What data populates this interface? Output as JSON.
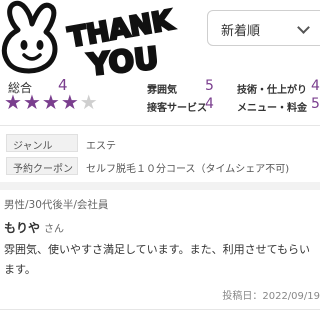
{
  "sort": {
    "selected": "新着順"
  },
  "ratings": {
    "overall_label": "総合",
    "overall_value": "4",
    "stars_filled": 4,
    "stars_total": 5,
    "categories": [
      {
        "label": "雰囲気",
        "value": "5"
      },
      {
        "label": "技術・仕上がり",
        "value": "4"
      },
      {
        "label": "接客サービス",
        "value": "4"
      },
      {
        "label": "メニュー・料金",
        "value": "5"
      }
    ]
  },
  "info": {
    "genre_label": "ジャンル",
    "genre_value": "エステ",
    "coupon_label": "予約クーポン",
    "coupon_value": "セルフ脱毛１０分コース（タイムシェア不可)"
  },
  "review": {
    "meta": "男性/30代後半/会社員",
    "author": "もりや",
    "honorific": "さん",
    "text": "雰囲気、使いやすさ満足しています。また、利用させてもらいます。",
    "posted": "投稿日：2022/09/19"
  },
  "sticker": {
    "text_line1": "THANK",
    "text_line2": "YOU"
  },
  "colors": {
    "accent": "#7a3e8e",
    "label_bg": "#f1f1f1"
  },
  "icons": {
    "sort": "chevron-down-icon",
    "stars": "star-icon",
    "sticker": "bunny-icon"
  }
}
